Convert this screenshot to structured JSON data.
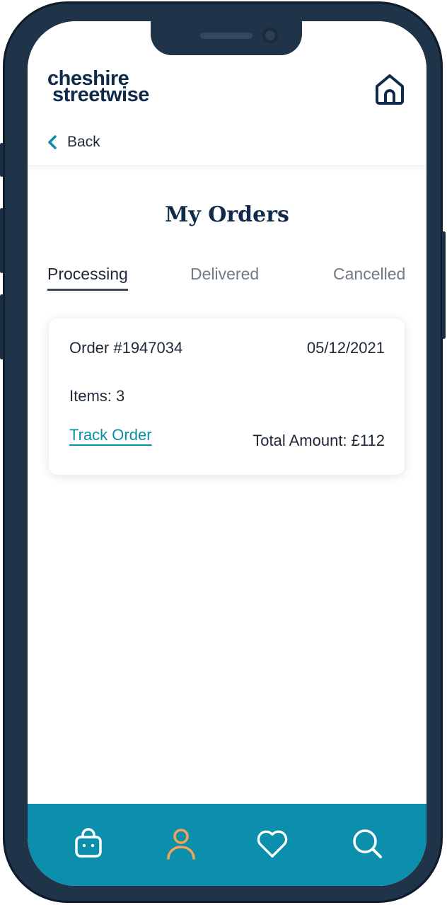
{
  "brand": {
    "line1": "cheshire",
    "line2": "streetwise"
  },
  "nav": {
    "back_label": "Back"
  },
  "page": {
    "title": "My Orders"
  },
  "tabs": [
    {
      "label": "Processing",
      "active": true
    },
    {
      "label": "Delivered",
      "active": false
    },
    {
      "label": "Cancelled",
      "active": false
    }
  ],
  "orders": [
    {
      "number": "Order #1947034",
      "date": "05/12/2021",
      "items": "Items: 3",
      "track_label": "Track Order",
      "total": "Total Amount: £112"
    }
  ],
  "bottom_nav": {
    "items": [
      {
        "icon": "shopping-bag-icon",
        "active": false
      },
      {
        "icon": "user-icon",
        "active": true
      },
      {
        "icon": "heart-icon",
        "active": false
      },
      {
        "icon": "search-icon",
        "active": false
      }
    ]
  },
  "colors": {
    "brand_navy": "#0f2a4a",
    "accent_teal": "#0c8ead",
    "active_icon": "#f5a451",
    "link": "#0b8fa8"
  }
}
